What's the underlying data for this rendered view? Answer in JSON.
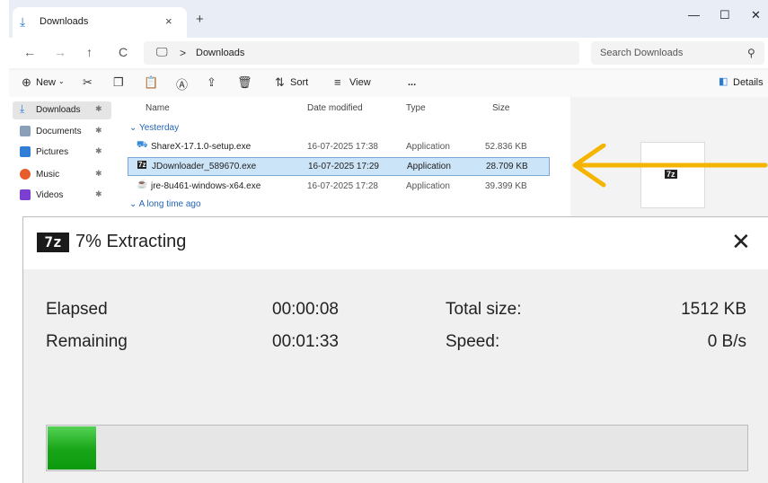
{
  "explorer": {
    "tab_title": "Downloads",
    "tab_close": "×",
    "new_tab": "+",
    "window_buttons": {
      "minimize": "—",
      "maximize": "☐",
      "close": "✕"
    },
    "nav": {
      "back": "←",
      "forward": "→",
      "up": "↑",
      "refresh": "C"
    },
    "address": {
      "separator": ">",
      "path": "Downloads"
    },
    "search_placeholder": "Search Downloads",
    "commands": {
      "new": "New",
      "sort": "Sort",
      "view": "View",
      "more": "...",
      "details": "Details"
    },
    "sidebar": [
      {
        "label": "Downloads",
        "color": "#2a7bd4",
        "selected": true
      },
      {
        "label": "Documents",
        "color": "#8aa0b8"
      },
      {
        "label": "Pictures",
        "color": "#2f7fd6"
      },
      {
        "label": "Music",
        "color": "#e65c2a"
      },
      {
        "label": "Videos",
        "color": "#7b3fd1"
      }
    ],
    "columns": {
      "name": "Name",
      "date": "Date modified",
      "type": "Type",
      "size": "Size"
    },
    "groups": {
      "yesterday": "Yesterday",
      "long_ago": "A long time ago"
    },
    "files": [
      {
        "name": "ShareX-17.1.0-setup.exe",
        "date": "16-07-2025 17:38",
        "type": "Application",
        "size": "52.836 KB"
      },
      {
        "name": "JDownloader_589670.exe",
        "date": "16-07-2025 17:29",
        "type": "Application",
        "size": "28.709 KB"
      },
      {
        "name": "jre-8u461-windows-x64.exe",
        "date": "16-07-2025 17:28",
        "type": "Application",
        "size": "39.399 KB"
      }
    ],
    "preview_icon_text": "7z"
  },
  "dialog": {
    "logo": "7z",
    "title": "7% Extracting",
    "close": "✕",
    "elapsed_label": "Elapsed",
    "elapsed_value": "00:00:08",
    "remaining_label": "Remaining",
    "remaining_value": "00:01:33",
    "total_size_label": "Total size:",
    "total_size_value": "1512 KB",
    "speed_label": "Speed:",
    "speed_value": "0 B/s",
    "progress_percent": 7,
    "progress_color": "#17a517"
  },
  "accent_arrow_color": "#f5b400"
}
